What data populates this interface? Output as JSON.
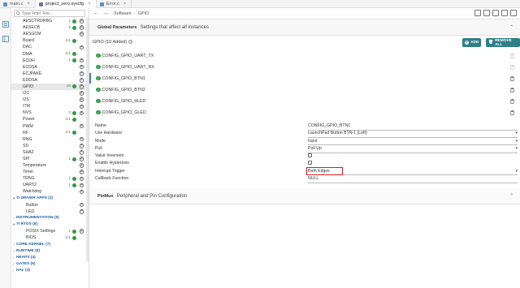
{
  "tabs": [
    {
      "label": "main.c",
      "color": "#5b8fc7",
      "active": false
    },
    {
      "label": "project_zero.syscfg",
      "color": "#7a6fb0",
      "active": true
    },
    {
      "label": "Error.c",
      "color": "#5b8fc7",
      "active": false
    }
  ],
  "sidebar": {
    "filter_placeholder": "Type Filter Text...",
    "items": [
      {
        "label": "AESCTRDRBG",
        "count": "1",
        "ok": true,
        "add": true,
        "type": "item"
      },
      {
        "label": "AESECB",
        "count": "1",
        "ok": true,
        "add": true,
        "type": "item"
      },
      {
        "label": "AESGCM",
        "count": "",
        "ok": false,
        "add": true,
        "type": "item"
      },
      {
        "label": "Board",
        "count": "1/1",
        "ok": true,
        "add": false,
        "type": "item"
      },
      {
        "label": "DAC",
        "count": "",
        "ok": false,
        "add": true,
        "type": "item"
      },
      {
        "label": "DMA",
        "count": "1/1",
        "ok": true,
        "add": false,
        "type": "item"
      },
      {
        "label": "ECDH",
        "count": "1",
        "ok": true,
        "add": true,
        "type": "item"
      },
      {
        "label": "ECDSA",
        "count": "",
        "ok": false,
        "add": true,
        "type": "item"
      },
      {
        "label": "ECJPAKE",
        "count": "",
        "ok": false,
        "add": true,
        "type": "item"
      },
      {
        "label": "EDDSA",
        "count": "",
        "ok": false,
        "add": true,
        "type": "item"
      },
      {
        "label": "GPIO",
        "count": "10",
        "ok": true,
        "add": true,
        "type": "item",
        "selected": true
      },
      {
        "label": "I2C",
        "count": "",
        "ok": false,
        "add": true,
        "type": "item"
      },
      {
        "label": "I2S",
        "count": "",
        "ok": false,
        "add": true,
        "type": "item"
      },
      {
        "label": "ITM",
        "count": "",
        "ok": false,
        "add": true,
        "type": "item"
      },
      {
        "label": "NVS",
        "count": "3",
        "ok": true,
        "add": true,
        "type": "item"
      },
      {
        "label": "Power",
        "count": "1/1",
        "ok": true,
        "add": false,
        "type": "item"
      },
      {
        "label": "PWM",
        "count": "",
        "ok": false,
        "add": true,
        "type": "item"
      },
      {
        "label": "RF",
        "count": "1/1",
        "ok": true,
        "add": false,
        "type": "item"
      },
      {
        "label": "RNG",
        "count": "",
        "ok": false,
        "add": true,
        "type": "item"
      },
      {
        "label": "SD",
        "count": "",
        "ok": false,
        "add": true,
        "type": "item"
      },
      {
        "label": "SHA2",
        "count": "",
        "ok": false,
        "add": true,
        "type": "item"
      },
      {
        "label": "SPI",
        "count": "1",
        "ok": true,
        "add": true,
        "type": "item"
      },
      {
        "label": "Temperature",
        "count": "",
        "ok": false,
        "add": true,
        "type": "item"
      },
      {
        "label": "Timer",
        "count": "",
        "ok": false,
        "add": true,
        "type": "item"
      },
      {
        "label": "TRNG",
        "count": "1",
        "ok": true,
        "add": true,
        "type": "item"
      },
      {
        "label": "UART2",
        "count": "1",
        "ok": true,
        "add": true,
        "type": "item"
      },
      {
        "label": "Watchdog",
        "count": "",
        "ok": false,
        "add": true,
        "type": "item"
      },
      {
        "label": "TI DRIVER APPS (2)",
        "chev": "▾",
        "type": "group"
      },
      {
        "label": "Button",
        "count": "",
        "ok": false,
        "add": true,
        "type": "child"
      },
      {
        "label": "LED",
        "count": "",
        "ok": false,
        "add": true,
        "type": "child"
      },
      {
        "label": "INSTRUMENTATION (5)",
        "chev": "›",
        "type": "group"
      },
      {
        "label": "TI RTOS (8)",
        "chev": "▾",
        "type": "group"
      },
      {
        "label": "POSIX Settings",
        "count": "1",
        "ok": true,
        "add": true,
        "type": "child"
      },
      {
        "label": "BIOS",
        "count": "1/1",
        "ok": true,
        "add": false,
        "type": "child"
      },
      {
        "label": "CORE KERNEL (7)",
        "chev": "›",
        "type": "group"
      },
      {
        "label": "RUNTIME (8)",
        "chev": "›",
        "type": "group"
      },
      {
        "label": "HEAPS (4)",
        "chev": "›",
        "type": "group"
      },
      {
        "label": "GATES (5)",
        "chev": "›",
        "type": "group"
      },
      {
        "label": "HAL (3)",
        "chev": "›",
        "type": "group"
      }
    ]
  },
  "toolbar": {
    "back": "←",
    "forward": "→",
    "breadcrumb_root": "Software",
    "breadcrumb_sep": "›",
    "breadcrumb_leaf": "GPIO"
  },
  "global": {
    "title": "Global Parameters",
    "subtitle": "Settings that affect all instances",
    "caret": "⌃"
  },
  "gpio": {
    "heading": "GPIO (10 Added)",
    "info": "?",
    "add_label": "ADD",
    "remove_all_label": "REMOVE ALL",
    "instances": [
      {
        "name": "CONFIG_GPIO_UART_TX",
        "selected": false,
        "deletable": false
      },
      {
        "name": "CONFIG_GPIO_UART_RX",
        "selected": false,
        "deletable": false
      },
      {
        "name": "CONFIG_GPIO_BTN1",
        "selected": true,
        "deletable": true
      },
      {
        "name": "CONFIG_GPIO_BTN2",
        "selected": false,
        "deletable": true
      },
      {
        "name": "CONFIG_GPIO_RLED",
        "selected": false,
        "deletable": true
      },
      {
        "name": "CONFIG_GPIO_GLED",
        "selected": false,
        "deletable": true
      }
    ]
  },
  "props": [
    {
      "label": "Name",
      "value": "CONFIG_GPIO_BTN1",
      "kind": "text"
    },
    {
      "label": "Use Hardware",
      "value": "LaunchPad Button BTN-1 (Left)",
      "kind": "select"
    },
    {
      "label": "Mode",
      "value": "Input",
      "kind": "select"
    },
    {
      "label": "Pull",
      "value": "Pull Up",
      "kind": "select"
    },
    {
      "label": "Value Inversion",
      "value": "",
      "kind": "checkbox"
    },
    {
      "label": "Enable Hysteresis",
      "value": "",
      "kind": "checkbox"
    },
    {
      "label": "Interrupt Trigger",
      "value": "Both Edges",
      "kind": "select",
      "highlight": true
    },
    {
      "label": "Callback Function",
      "value": "NULL",
      "kind": "text"
    }
  ],
  "pinmux": {
    "title": "PinMux",
    "subtitle": "Peripheral and Pin Configuration",
    "caret": "⌃"
  },
  "colors": {
    "accent": "#2f7f86",
    "ok": "#2e9d3e",
    "highlight": "#d42020",
    "link": "#1b5fa0"
  }
}
